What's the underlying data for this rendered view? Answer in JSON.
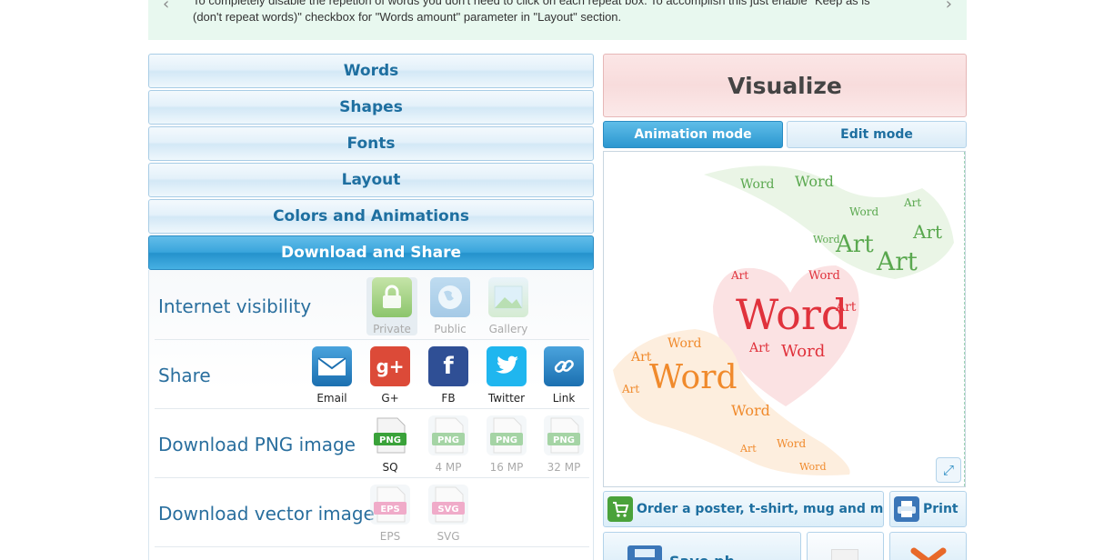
{
  "tip": {
    "line1": "To completely disable the repetion of words you don't need to click on each repeat box. To accomplish this just enable \"Keep as is",
    "line2": "(don't repeat words)\" checkbox for \"Words amount\" parameter in \"Layout\" section."
  },
  "accordion": {
    "words": "Words",
    "shapes": "Shapes",
    "fonts": "Fonts",
    "layout": "Layout",
    "colors": "Colors and Animations",
    "download": "Download and Share"
  },
  "visibility": {
    "label": "Internet visibility",
    "private": "Private",
    "public": "Public",
    "gallery": "Gallery"
  },
  "share": {
    "label": "Share",
    "email": "Email",
    "gplus": "G+",
    "fb": "FB",
    "twitter": "Twitter",
    "link": "Link"
  },
  "png": {
    "label": "Download PNG image",
    "badge": "PNG",
    "sq": "SQ",
    "mp4": "4 MP",
    "mp16": "16 MP",
    "mp32": "32 MP"
  },
  "vector": {
    "label": "Download vector image",
    "eps_badge": "EPS",
    "svg_badge": "SVG",
    "eps": "EPS",
    "svg": "SVG"
  },
  "visualize": "Visualize",
  "modes": {
    "animation": "Animation mode",
    "edit": "Edit mode"
  },
  "cloud_words": {
    "word": "Word",
    "art": "Art"
  },
  "order": "Order a poster, t-shirt, mug and more",
  "print": "Print",
  "save": "Save ph",
  "colors": {
    "accent": "#2a8cc3",
    "green": "#5aa84f",
    "red": "#e0323c",
    "orange": "#f08a2c"
  }
}
